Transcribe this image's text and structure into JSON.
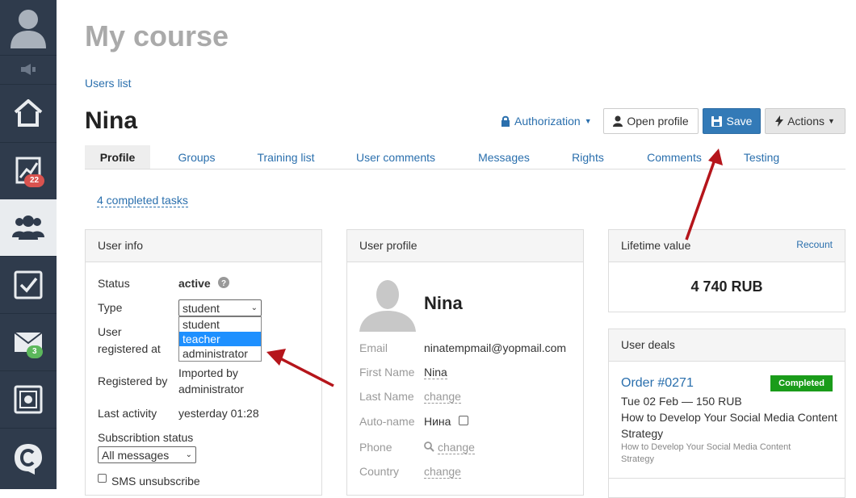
{
  "sidebar": {
    "items": [
      {
        "name": "avatar"
      },
      {
        "name": "megaphone"
      },
      {
        "name": "home"
      },
      {
        "name": "stats",
        "badge": "22"
      },
      {
        "name": "users"
      },
      {
        "name": "tasks"
      },
      {
        "name": "mail",
        "badge": "3"
      },
      {
        "name": "safe"
      },
      {
        "name": "logo"
      }
    ],
    "badge_colors": {
      "stats": "#d9534f",
      "mail": "#5cb85c"
    }
  },
  "page": {
    "title": "My course",
    "breadcrumb": "Users list",
    "user_name": "Nina"
  },
  "toolbar": {
    "authorization": "Authorization",
    "open_profile": "Open profile",
    "save": "Save",
    "actions": "Actions"
  },
  "tabs": [
    "Profile",
    "Groups",
    "Training list",
    "User comments",
    "Messages",
    "Rights",
    "Comments",
    "Testing"
  ],
  "completed_tasks": "4 completed tasks",
  "user_info": {
    "title": "User info",
    "status_label": "Status",
    "status_value": "active",
    "type_label": "Type",
    "type_value": "student",
    "type_options": [
      "student",
      "teacher",
      "administrator"
    ],
    "registered_at_label_1": "User",
    "registered_at_label_2": "registered at",
    "registered_by_label": "Registered by",
    "registered_by_value_1": "Imported by",
    "registered_by_value_2": "administrator",
    "last_activity_label": "Last activity",
    "last_activity_value": "yesterday 01:28",
    "subscription_label": "Subscribtion status",
    "subscription_value": "All messages",
    "sms_label": "SMS unsubscribe"
  },
  "user_profile": {
    "title": "User profile",
    "name": "Nina",
    "email_label": "Email",
    "email_value": "ninatempmail@yopmail.com",
    "first_name_label": "First Name",
    "first_name_value": "Nina",
    "last_name_label": "Last Name",
    "last_name_value": "change",
    "auto_name_label": "Auto-name",
    "auto_name_value": "Нина",
    "phone_label": "Phone",
    "phone_value": "change",
    "country_label": "Country",
    "country_value": "change"
  },
  "lifetime": {
    "title": "Lifetime value",
    "recount": "Recount",
    "value": "4 740 RUB"
  },
  "deals": {
    "title": "User deals",
    "order": "Order #0271",
    "status": "Completed",
    "date": "Tue 02 Feb — 150 RUB",
    "product_1": "How to Develop Your Social Media Content",
    "product_2": "Strategy",
    "sub_1": "How to Develop Your Social Media Content",
    "sub_2": "Strategy"
  },
  "colors": {
    "accent": "#2a6fad",
    "save_btn": "#337ab7",
    "completed": "#1a9c1a",
    "arrow": "#b5151b"
  }
}
